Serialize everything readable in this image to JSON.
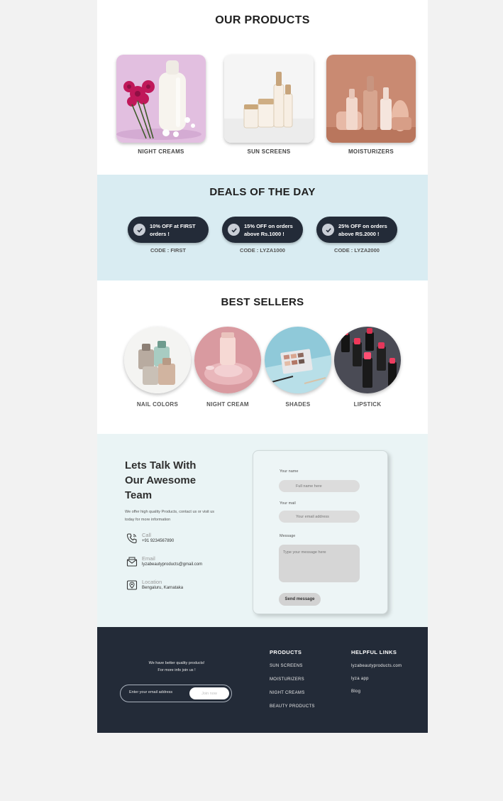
{
  "products": {
    "title": "OUR PRODUCTS",
    "items": [
      {
        "label": "NIGHT CREAMS"
      },
      {
        "label": "SUN SCREENS"
      },
      {
        "label": "MOISTURIZERS"
      }
    ]
  },
  "deals": {
    "title": "DEALS OF THE DAY",
    "items": [
      {
        "line1": "10% OFF at FIRST",
        "line2": "orders !",
        "code": "CODE : FIRST"
      },
      {
        "line1": "15% OFF on orders",
        "line2": "above Rs.1000 !",
        "code": "CODE : LYZA1000"
      },
      {
        "line1": "25% OFF on orders",
        "line2": "above RS.2000 !",
        "code": "CODE : LYZA2000"
      }
    ]
  },
  "best": {
    "title": "BEST SELLERS",
    "items": [
      {
        "label": "NAIL COLORS"
      },
      {
        "label": "NIGHT CREAM"
      },
      {
        "label": "SHADES"
      },
      {
        "label": "LIPSTICK"
      }
    ]
  },
  "contact": {
    "heading_line1": "Lets Talk With",
    "heading_line2": "Our Awesome",
    "heading_line3": "Team",
    "desc_line1": "We offer high quality  Products, contact us or visit us",
    "desc_line2": "today for more information",
    "call_label": "Call",
    "call_value": "+91 9234567890",
    "email_label": "Email",
    "email_value": "lyzabeautyproducts@gmail.com",
    "location_label": "Location",
    "location_value": "Bengaluru, Karnataka"
  },
  "form": {
    "name_label": "Your name",
    "name_placeholder": "Full name here",
    "mail_label": "Your mail",
    "mail_placeholder": "Your email address",
    "message_label": "Message",
    "message_placeholder": "Type your message here",
    "send_label": "Send message"
  },
  "footer": {
    "tag_line1": "We have better quality products!",
    "tag_line2": "For more info join us !",
    "email_placeholder": "Enter your email address",
    "join_label": "Join now",
    "products_head": "PRODUCTS",
    "products_links": [
      "SUN SCREENS",
      "MOISTURIZERS",
      "NIGHT CREAMS",
      "BEAUTY PRODUCTS"
    ],
    "helpful_head": "HELPFUL LINKS",
    "helpful_links": [
      "lyzabeautyproducts.com",
      "lyza app",
      "Blog"
    ]
  },
  "colors": {
    "deals_bg": "#d9ecf2",
    "contact_bg": "#eaf4f5",
    "dark": "#232b38"
  }
}
